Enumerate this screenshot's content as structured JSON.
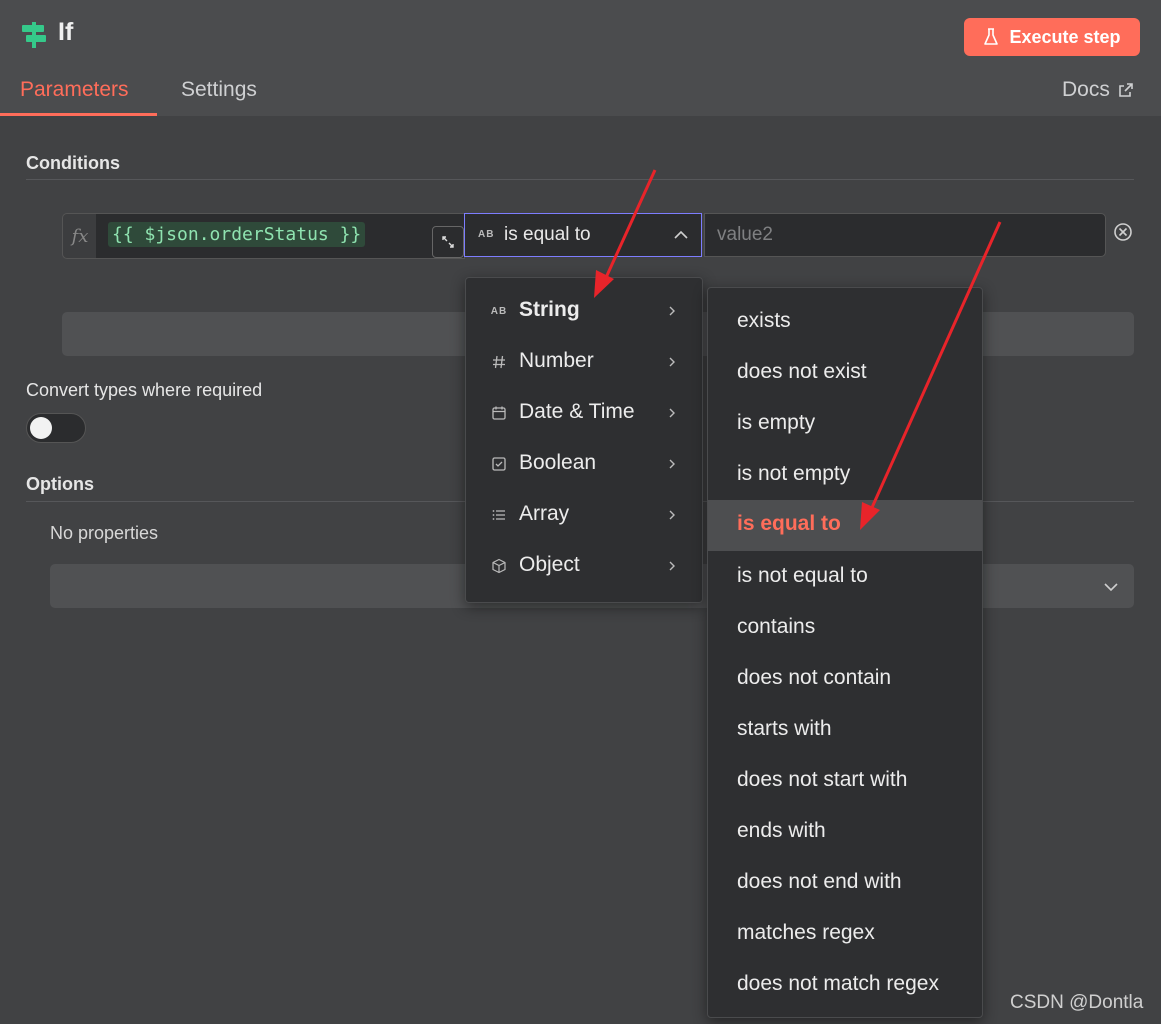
{
  "header": {
    "node_title": "If",
    "execute_label": "Execute step",
    "tabs": [
      {
        "label": "Parameters"
      },
      {
        "label": "Settings"
      }
    ],
    "docs_label": "Docs"
  },
  "conditions": {
    "section_label": "Conditions",
    "left_value": "{{ $json.orderStatus }}",
    "operator_type_badge": "AB",
    "operator_label": "is equal to",
    "right_placeholder": "value2"
  },
  "convert_types": {
    "label": "Convert types where required",
    "enabled": false
  },
  "options": {
    "section_label": "Options",
    "empty_text": "No properties"
  },
  "type_menu": {
    "items": [
      {
        "label": "String",
        "icon": "string-ab-icon"
      },
      {
        "label": "Number",
        "icon": "hash-icon"
      },
      {
        "label": "Date & Time",
        "icon": "calendar-icon"
      },
      {
        "label": "Boolean",
        "icon": "checkbox-icon"
      },
      {
        "label": "Array",
        "icon": "list-icon"
      },
      {
        "label": "Object",
        "icon": "cube-icon"
      }
    ],
    "string_badge": "AB"
  },
  "operator_menu": {
    "selected": "is equal to",
    "items": [
      {
        "label": "exists"
      },
      {
        "label": "does not exist"
      },
      {
        "label": "is empty"
      },
      {
        "label": "is not empty"
      },
      {
        "label": "is equal to"
      },
      {
        "label": "is not equal to"
      },
      {
        "label": "contains"
      },
      {
        "label": "does not contain"
      },
      {
        "label": "starts with"
      },
      {
        "label": "does not start with"
      },
      {
        "label": "ends with"
      },
      {
        "label": "does not end with"
      },
      {
        "label": "matches regex"
      },
      {
        "label": "does not match regex"
      }
    ]
  },
  "watermark": "CSDN @Dontla",
  "colors": {
    "accent": "#ff6d5a",
    "background": "#414244",
    "header": "#4b4c4e",
    "menu": "#2e2f31",
    "expression_green": "#8fe3b0",
    "annotation_arrow": "#e8242a"
  }
}
